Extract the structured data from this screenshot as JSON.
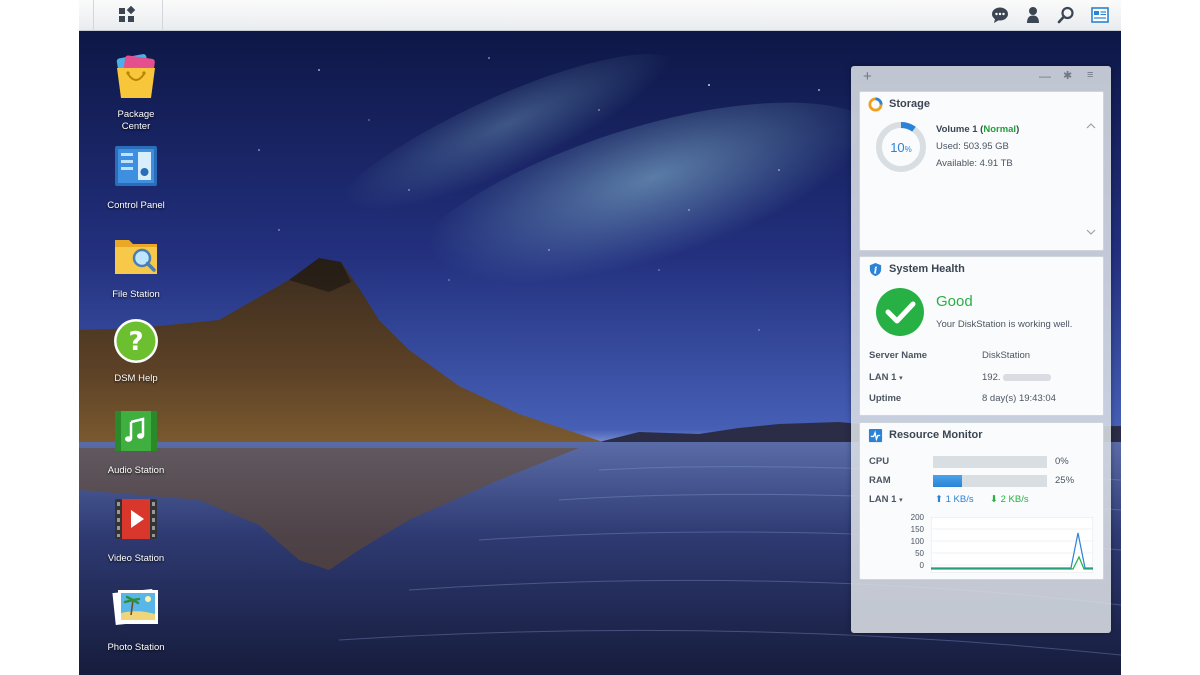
{
  "desktop_icons": [
    {
      "label": "Package\nCenter",
      "icon": "package-center-icon"
    },
    {
      "label": "Control Panel",
      "icon": "control-panel-icon"
    },
    {
      "label": "File Station",
      "icon": "file-station-icon"
    },
    {
      "label": "DSM Help",
      "icon": "dsm-help-icon"
    },
    {
      "label": "Audio Station",
      "icon": "audio-station-icon"
    },
    {
      "label": "Video Station",
      "icon": "video-station-icon"
    },
    {
      "label": "Photo Station",
      "icon": "photo-station-icon"
    }
  ],
  "taskbar": {
    "icons": [
      "main-menu-icon",
      "notification-icon",
      "user-icon",
      "search-icon",
      "widgets-icon"
    ]
  },
  "widgets": {
    "header": {
      "add": "+",
      "minimize": "—",
      "pin": "✱",
      "menu": "≡"
    },
    "storage": {
      "title": "Storage",
      "percent": "10",
      "percent_unit": "%",
      "usage_fraction": 0.1,
      "volume_name": "Volume 1 (",
      "volume_status": "Normal",
      "volume_close": ")",
      "used": "Used: 503.95 GB",
      "available": "Available: 4.91 TB"
    },
    "health": {
      "title": "System Health",
      "status": "Good",
      "message": "Your DiskStation is working well.",
      "rows": [
        {
          "label": "Server Name",
          "value": "DiskStation"
        },
        {
          "label": "LAN 1",
          "value": "192."
        },
        {
          "label": "Uptime",
          "value": "8 day(s) 19:43:04"
        }
      ]
    },
    "resource_monitor": {
      "title": "Resource Monitor",
      "cpu_label": "CPU",
      "cpu_value": "0%",
      "cpu_fraction": 0.0,
      "ram_label": "RAM",
      "ram_value": "25%",
      "ram_fraction": 0.25,
      "lan_label": "LAN 1",
      "upload": "1 KB/s",
      "download": "2 KB/s",
      "chart_ticks": [
        "200",
        "150",
        "100",
        "50",
        "0"
      ]
    }
  },
  "colors": {
    "accent": "#2a83d6",
    "good": "#27b043",
    "normal": "#22a03a"
  }
}
